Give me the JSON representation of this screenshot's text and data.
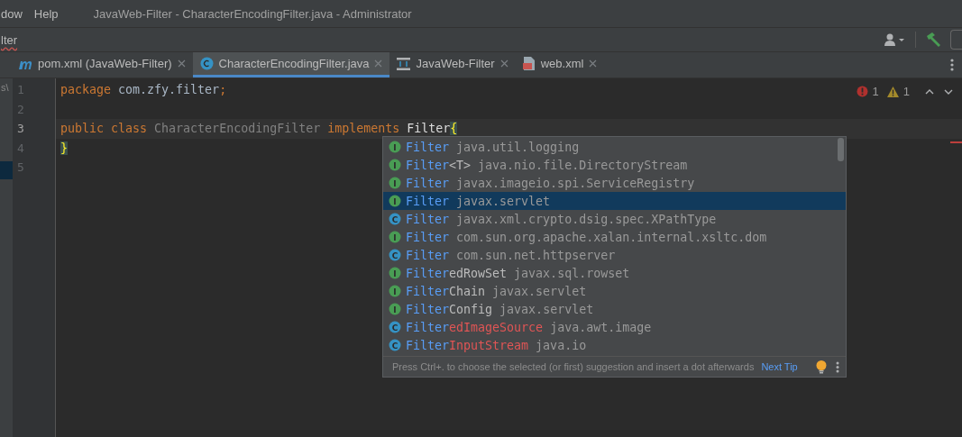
{
  "menu": [
    {
      "label": "dow"
    },
    {
      "label": "Help"
    }
  ],
  "window": {
    "title": "JavaWeb-Filter - CharacterEncodingFilter.java - Administrator"
  },
  "breadcrumb": "lter",
  "tabs": [
    {
      "label": "pom.xml (JavaWeb-Filter)",
      "kind": "maven",
      "selected": false
    },
    {
      "label": "CharacterEncodingFilter.java",
      "kind": "class",
      "selected": true
    },
    {
      "label": "JavaWeb-Filter",
      "kind": "structure",
      "selected": false
    },
    {
      "label": "web.xml",
      "kind": "xml",
      "selected": false
    }
  ],
  "project_panel_fragment": "s\\",
  "inspections": {
    "errors": "1",
    "warnings": "1"
  },
  "editor": {
    "lines": [
      {
        "number": "1",
        "current": false,
        "tokens": [
          {
            "kind": "keyword",
            "text": "package"
          },
          {
            "kind": "plain",
            "text": " com.zfy.filter"
          },
          {
            "kind": "keyword",
            "text": ";"
          }
        ]
      },
      {
        "number": "2",
        "current": false
      },
      {
        "number": "3",
        "current": true,
        "tokens": [
          {
            "kind": "keyword",
            "text": "public class "
          },
          {
            "kind": "unused",
            "text": "CharacterEncodingFilter "
          },
          {
            "kind": "keyword",
            "text": "implements "
          },
          {
            "kind": "error",
            "text": "Filter"
          },
          {
            "kind": "brace",
            "text": "{"
          }
        ]
      },
      {
        "number": "4",
        "current": false,
        "tokens": [
          {
            "kind": "brace",
            "text": "}"
          }
        ]
      },
      {
        "number": "5",
        "current": false
      }
    ]
  },
  "completion": {
    "items": [
      {
        "icon": "I",
        "kind": "interface",
        "match": "Filter",
        "package": "java.util.logging",
        "selected": false
      },
      {
        "icon": "I",
        "kind": "interface",
        "match": "Filter",
        "rest": "<T>",
        "deprecated": false,
        "package": "java.nio.file.DirectoryStream",
        "selected": false
      },
      {
        "icon": "I",
        "kind": "interface",
        "match": "Filter",
        "package": "javax.imageio.spi.ServiceRegistry",
        "selected": false
      },
      {
        "icon": "I",
        "kind": "interface",
        "match": "Filter",
        "package": "javax.servlet",
        "selected": true
      },
      {
        "icon": "C",
        "kind": "class",
        "match": "Filter",
        "package": "javax.xml.crypto.dsig.spec.XPathType",
        "selected": false
      },
      {
        "icon": "I",
        "kind": "interface",
        "match": "Filter",
        "package": "com.sun.org.apache.xalan.internal.xsltc.dom",
        "selected": false
      },
      {
        "icon": "C",
        "kind": "class",
        "match": "Filter",
        "package": "com.sun.net.httpserver",
        "selected": false
      },
      {
        "icon": "I",
        "kind": "interface",
        "match": "Filter",
        "rest": "edRowSet",
        "deprecated": false,
        "package": "javax.sql.rowset",
        "selected": false
      },
      {
        "icon": "I",
        "kind": "interface",
        "match": "Filter",
        "rest": "Chain",
        "deprecated": false,
        "package": "javax.servlet",
        "selected": false
      },
      {
        "icon": "I",
        "kind": "interface",
        "match": "Filter",
        "rest": "Config",
        "deprecated": false,
        "package": "javax.servlet",
        "selected": false
      },
      {
        "icon": "C",
        "kind": "class",
        "match": "Filter",
        "rest": "edImageSource",
        "deprecated": true,
        "package": "java.awt.image",
        "selected": false
      },
      {
        "icon": "C",
        "kind": "class",
        "match": "Filter",
        "rest": "InputStream",
        "deprecated": true,
        "package": "java.io",
        "selected": false
      }
    ],
    "hint": "Press Ctrl+. to choose the selected (or first) suggestion and insert a dot afterwards",
    "next_tip": "Next Tip"
  }
}
